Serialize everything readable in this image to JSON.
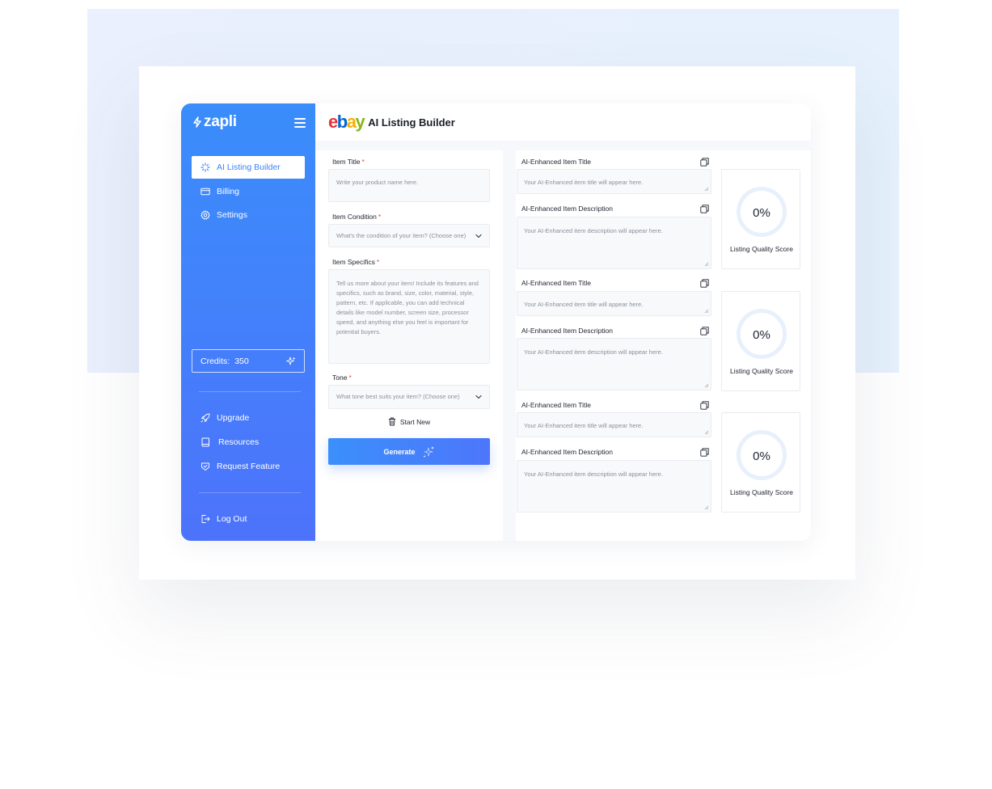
{
  "sidebar": {
    "logo_text": "zapli",
    "nav": [
      {
        "label": "AI Listing Builder",
        "icon": "spinner-icon",
        "active": true
      },
      {
        "label": "Billing",
        "icon": "card-icon",
        "active": false
      },
      {
        "label": "Settings",
        "icon": "gear-icon",
        "active": false
      }
    ],
    "credits_label": "Credits:",
    "credits_value": "350",
    "bottom_nav": [
      {
        "label": "Upgrade",
        "icon": "rocket-icon"
      },
      {
        "label": "Resources",
        "icon": "book-icon"
      },
      {
        "label": "Request Feature",
        "icon": "badge-check-icon"
      }
    ],
    "logout_label": "Log Out"
  },
  "header": {
    "logo": [
      "e",
      "b",
      "a",
      "y"
    ],
    "title": "AI Listing Builder"
  },
  "form": {
    "item_title": {
      "label": "Item Title",
      "required": "*",
      "placeholder": "Write your product name here."
    },
    "item_condition": {
      "label": "Item Condition",
      "required": "*",
      "placeholder": "What's the condition of your item? (Choose one)"
    },
    "item_specifics": {
      "label": "Item Specifics",
      "required": "*",
      "placeholder": "Tell us more about your item! Include its features and specifics, such as brand, size, color, material, style, pattern, etc. If applicable, you can add technical details like model number, screen size, processor speed, and anything else you feel is important for potential buyers."
    },
    "tone": {
      "label": "Tone",
      "required": "*",
      "placeholder": "What tone best suits your item? (Choose one)"
    },
    "start_new": "Start New",
    "generate": "Generate"
  },
  "results": [
    {
      "title_label": "AI-Enhanced Item Title",
      "title_placeholder": "Your AI-Enhanced item title will appear here.",
      "desc_label": "AI-Enhanced Item Description",
      "desc_placeholder": "Your AI-Enhanced item description will appear here.",
      "score": "0%",
      "score_label": "Listing Quality Score",
      "score_value": 0
    },
    {
      "title_label": "AI-Enhanced Item Title",
      "title_placeholder": "Your AI-Enhanced item title will appear here.",
      "desc_label": "AI-Enhanced Item Description",
      "desc_placeholder": "Your AI-Enhanced item description will appear here.",
      "score": "0%",
      "score_label": "Listing Quality Score",
      "score_value": 0
    },
    {
      "title_label": "AI-Enhanced Item Title",
      "title_placeholder": "Your AI-Enhanced item title will appear here.",
      "desc_label": "AI-Enhanced Item Description",
      "desc_placeholder": "Your AI-Enhanced item description will appear here.",
      "score": "0%",
      "score_label": "Listing Quality Score",
      "score_value": 0
    }
  ],
  "colors": {
    "accent": "#3c84f9",
    "sidebar_top": "#3a8dfb",
    "sidebar_bottom": "#4d73fb",
    "required": "#e5484d",
    "ring": "#e8f0fc"
  }
}
